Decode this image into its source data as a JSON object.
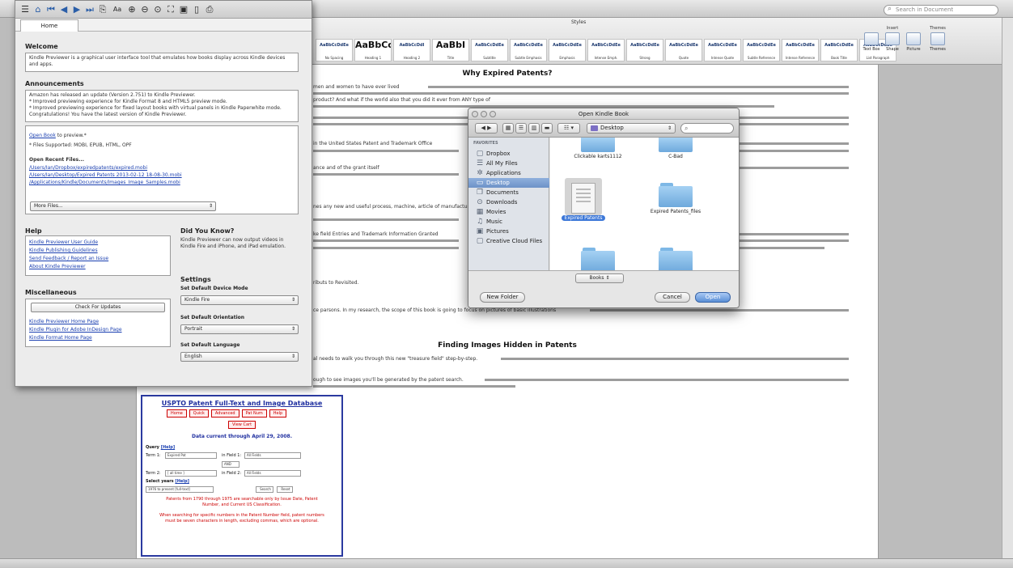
{
  "word": {
    "search_placeholder": "Search in Document",
    "ribbon_section": "Styles",
    "styles": [
      {
        "sample": "AaBbCcDdEe",
        "name": "No Spacing"
      },
      {
        "sample": "AaBbCcI",
        "name": "Heading 1",
        "big": true
      },
      {
        "sample": "AaBbCcDdI",
        "name": "Heading 2"
      },
      {
        "sample": "AaBbI",
        "name": "Title",
        "big": true
      },
      {
        "sample": "AaBbCcDdEe",
        "name": "Subtitle"
      },
      {
        "sample": "AaBbCcDdEe",
        "name": "Subtle Emphasis"
      },
      {
        "sample": "AaBbCcDdEe",
        "name": "Emphasis"
      },
      {
        "sample": "AaBbCcDdEe",
        "name": "Intense Emph."
      },
      {
        "sample": "AaBbCcDdEe",
        "name": "Strong"
      },
      {
        "sample": "AaBbCcDdEe",
        "name": "Quote"
      },
      {
        "sample": "AaBbCcDdEe",
        "name": "Intense Quote"
      },
      {
        "sample": "AaBbCcDdEe",
        "name": "Subtle Reference"
      },
      {
        "sample": "AaBbCcDdEe",
        "name": "Intense Reference"
      },
      {
        "sample": "AaBbCcDdEe",
        "name": "Book Title"
      },
      {
        "sample": "AaBbCcDdEe",
        "name": "List Paragraph"
      }
    ],
    "ribbon_groups": [
      {
        "title": "Insert",
        "buttons": [
          "Text Box",
          "Shape",
          "Picture"
        ]
      },
      {
        "title": "Themes",
        "buttons": [
          "Themes"
        ]
      }
    ],
    "doc": {
      "heading1": "Why Expired Patents?",
      "heading2": "Finding Images Hidden in Patents",
      "fragments": {
        "t1": "men and women to have ever lived",
        "t2": "product? And what if the world also that you did it ever from ANY type of",
        "t3": "interest in the section, and",
        "t4": "in the United States Patent and Trademark Office",
        "t5": "ance and of the grant itself",
        "t6": "nes any new and useful process, machine, article of manufacture",
        "t7": "ke field Entries and Trademark Information Granted",
        "t8": "ributs to Revisited.",
        "t9": "ce parsons. In my research, the scope of this book is going to focus on pictures of basic illustrations",
        "t10": "al needs to walk you through this new \"treasure field\" step-by-step.",
        "t11": "ough to see images you'll be generated by the patent search."
      }
    },
    "uspto": {
      "title": "USPTO Patent Full-Text and Image Database",
      "buttons": [
        "Home",
        "Quick",
        "Advanced",
        "Pat Num",
        "Help"
      ],
      "view_cart": "View Cart",
      "subtitle": "Data current through April 29, 2008.",
      "query_label": "Query",
      "help_link": "[Help]",
      "term1_label": "Term 1:",
      "term1_value": "Expired Pat",
      "field1_label": "in Field 1:",
      "field1_value": "All Fields",
      "op_value": "AND",
      "term2_label": "Term 2:",
      "term2_value": "[ all time ]",
      "field2_label": "in Field 2:",
      "field2_value": "All Fields",
      "years_label": "Select years",
      "years_value": "1976 to present [full-text]",
      "search_btn": "Search",
      "reset_btn": "Reset",
      "note1": "Patents from 1790 through 1975 are searchable only by Issue Date, Patent Number, and Current US Classification.",
      "note2": "When searching for specific numbers in the Patent Number field, patent numbers must be seven characters in length, excluding commas, which are optional."
    }
  },
  "kindle": {
    "tab_home": "Home",
    "welcome": {
      "title": "Welcome",
      "text": "Kindle Previewer is a graphical user interface tool that emulates how books display across Kindle devices and apps."
    },
    "announcements": {
      "title": "Announcements",
      "text": "Amazon has released an update (Version 2.751) to Kindle Previewer.\n* Improved previewing experience for Kindle Format 8 and HTML5 preview mode.\n* Improved previewing experience for fixed layout books with virtual panels in Kindle Paperwhite mode.\nCongratulations! You have the latest version of Kindle Previewer."
    },
    "open": {
      "link": "Open Book",
      "suffix": " to preview.*",
      "supported": "* Files Supported: MOBI, EPUB, HTML, OPF",
      "recent_title": "Open Recent Files...",
      "recent": [
        "/Users/Ian/Dropbox/expiredpatents/expired.mobi",
        "/Users/Ian/Desktop/Expired Patents 2013-02-12 18-08-30.mobi",
        "/Applications/Kindle/Documents/Images_Image_Samples.mobi"
      ],
      "more_files": "More Files..."
    },
    "help": {
      "title": "Help",
      "links": [
        "Kindle Previewer User Guide",
        "Kindle Publishing Guidelines",
        "Send Feedback / Report an Issue",
        "About Kindle Previewer"
      ]
    },
    "did_you_know": {
      "title": "Did You Know?",
      "text": "Kindle Previewer can now output videos in Kindle Fire and iPhone, and iPad emulation."
    },
    "misc": {
      "title": "Miscellaneous",
      "check_updates": "Check For Updates",
      "links": [
        "Kindle Previewer Home Page",
        "Kindle Plugin for Adobe InDesign Page",
        "Kindle Format Home Page"
      ]
    },
    "settings": {
      "title": "Settings",
      "device_label": "Set Default Device Mode",
      "device_value": "Kindle Fire",
      "orientation_label": "Set Default Orientation",
      "orientation_value": "Portrait",
      "language_label": "Set Default Language",
      "language_value": "English"
    }
  },
  "dialog": {
    "title": "Open Kindle Book",
    "location": "Desktop",
    "favorites_header": "FAVORITES",
    "sidebar": [
      {
        "label": "Dropbox",
        "icon": "dropbox-icon",
        "glyph": "▢"
      },
      {
        "label": "All My Files",
        "icon": "all-files-icon",
        "glyph": "☰"
      },
      {
        "label": "Applications",
        "icon": "applications-icon",
        "glyph": "✲"
      },
      {
        "label": "Desktop",
        "icon": "desktop-icon",
        "glyph": "▭",
        "selected": true
      },
      {
        "label": "Documents",
        "icon": "documents-icon",
        "glyph": "❐"
      },
      {
        "label": "Downloads",
        "icon": "downloads-icon",
        "glyph": "⊙"
      },
      {
        "label": "Movies",
        "icon": "movies-icon",
        "glyph": "▦"
      },
      {
        "label": "Music",
        "icon": "music-icon",
        "glyph": "♫"
      },
      {
        "label": "Pictures",
        "icon": "pictures-icon",
        "glyph": "▣"
      },
      {
        "label": "Creative Cloud Files",
        "icon": "creative-cloud-icon",
        "glyph": "▢"
      }
    ],
    "files": [
      {
        "name": "Clickable karts1112",
        "kind": "folder"
      },
      {
        "name": "C-Bad",
        "kind": "folder"
      },
      {
        "name": "Expired Patents",
        "kind": "document",
        "selected": true
      },
      {
        "name": "Expired Patents_files",
        "kind": "folder"
      },
      {
        "name": "",
        "kind": "folder"
      },
      {
        "name": "",
        "kind": "folder"
      }
    ],
    "format": "Books",
    "new_folder": "New Folder",
    "cancel": "Cancel",
    "open": "Open"
  }
}
